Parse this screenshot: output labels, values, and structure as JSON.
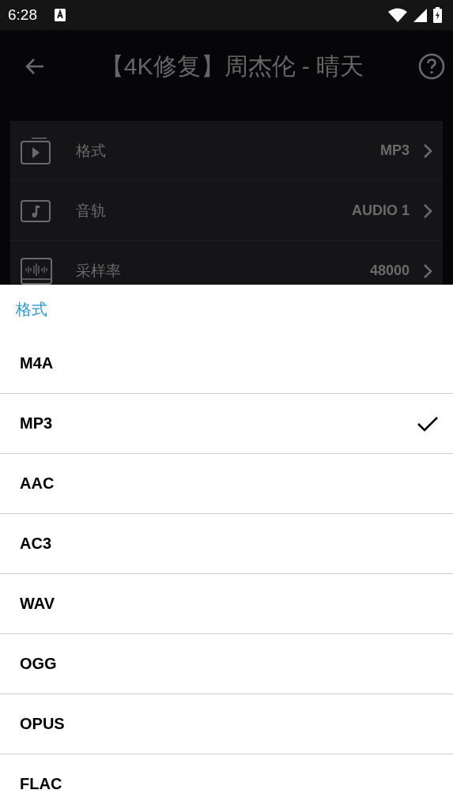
{
  "status_bar": {
    "time": "6:28"
  },
  "app_bar": {
    "title": "【4K修复】周杰伦 - 晴天"
  },
  "settings": [
    {
      "kind": "format",
      "label": "格式",
      "value": "MP3"
    },
    {
      "kind": "track",
      "label": "音轨",
      "value": "AUDIO 1"
    },
    {
      "kind": "sample_rate",
      "label": "采样率",
      "value": "48000"
    }
  ],
  "sheet": {
    "title": "格式",
    "options": [
      {
        "label": "M4A",
        "selected": false
      },
      {
        "label": "MP3",
        "selected": true
      },
      {
        "label": "AAC",
        "selected": false
      },
      {
        "label": "AC3",
        "selected": false
      },
      {
        "label": "WAV",
        "selected": false
      },
      {
        "label": "OGG",
        "selected": false
      },
      {
        "label": "OPUS",
        "selected": false
      },
      {
        "label": "FLAC",
        "selected": false
      }
    ]
  }
}
